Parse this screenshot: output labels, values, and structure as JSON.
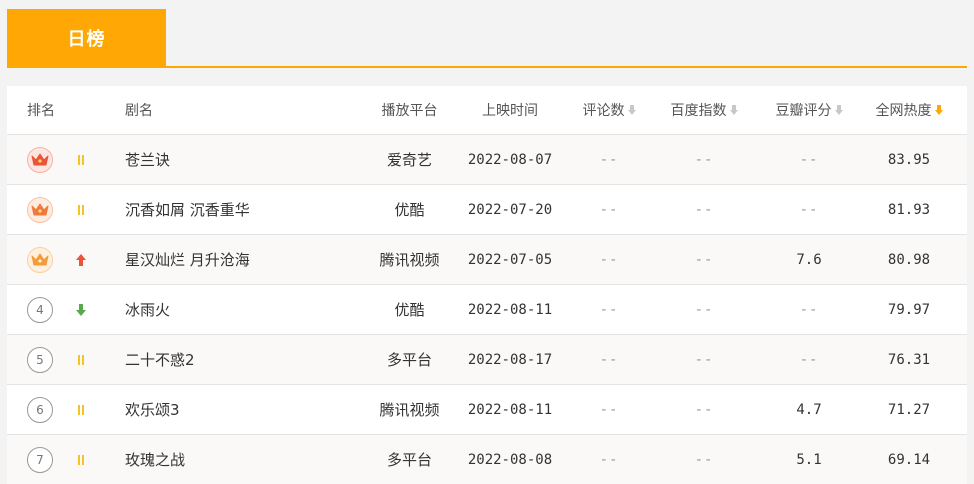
{
  "tabs": [
    {
      "label": "日榜",
      "active": true
    }
  ],
  "colors": {
    "accent": "#ffa705",
    "up": "#e8553c",
    "down": "#5aa84c",
    "hold": "#f5c326"
  },
  "columns": {
    "rank": "排名",
    "name": "剧名",
    "platform": "播放平台",
    "release": "上映时间",
    "comments": "评论数",
    "baidu": "百度指数",
    "douban": "豆瓣评分",
    "heat": "全网热度"
  },
  "rows": [
    {
      "rank": "1",
      "badge": "crown-icon",
      "trend": "hold",
      "name": "苍兰诀",
      "platform": "爱奇艺",
      "release": "2022-08-07",
      "comments": "--",
      "baidu": "--",
      "douban": "--",
      "heat": "83.95"
    },
    {
      "rank": "2",
      "badge": "crown-icon",
      "trend": "hold",
      "name": "沉香如屑 沉香重华",
      "platform": "优酷",
      "release": "2022-07-20",
      "comments": "--",
      "baidu": "--",
      "douban": "--",
      "heat": "81.93"
    },
    {
      "rank": "3",
      "badge": "crown-icon",
      "trend": "up",
      "name": "星汉灿烂 月升沧海",
      "platform": "腾讯视频",
      "release": "2022-07-05",
      "comments": "--",
      "baidu": "--",
      "douban": "7.6",
      "heat": "80.98"
    },
    {
      "rank": "4",
      "trend": "down",
      "name": "冰雨火",
      "platform": "优酷",
      "release": "2022-08-11",
      "comments": "--",
      "baidu": "--",
      "douban": "--",
      "heat": "79.97"
    },
    {
      "rank": "5",
      "trend": "hold",
      "name": "二十不惑2",
      "platform": "多平台",
      "release": "2022-08-17",
      "comments": "--",
      "baidu": "--",
      "douban": "--",
      "heat": "76.31"
    },
    {
      "rank": "6",
      "trend": "hold",
      "name": "欢乐颂3",
      "platform": "腾讯视频",
      "release": "2022-08-11",
      "comments": "--",
      "baidu": "--",
      "douban": "4.7",
      "heat": "71.27"
    },
    {
      "rank": "7",
      "trend": "hold",
      "name": "玫瑰之战",
      "platform": "多平台",
      "release": "2022-08-08",
      "comments": "--",
      "baidu": "--",
      "douban": "5.1",
      "heat": "69.14"
    }
  ]
}
